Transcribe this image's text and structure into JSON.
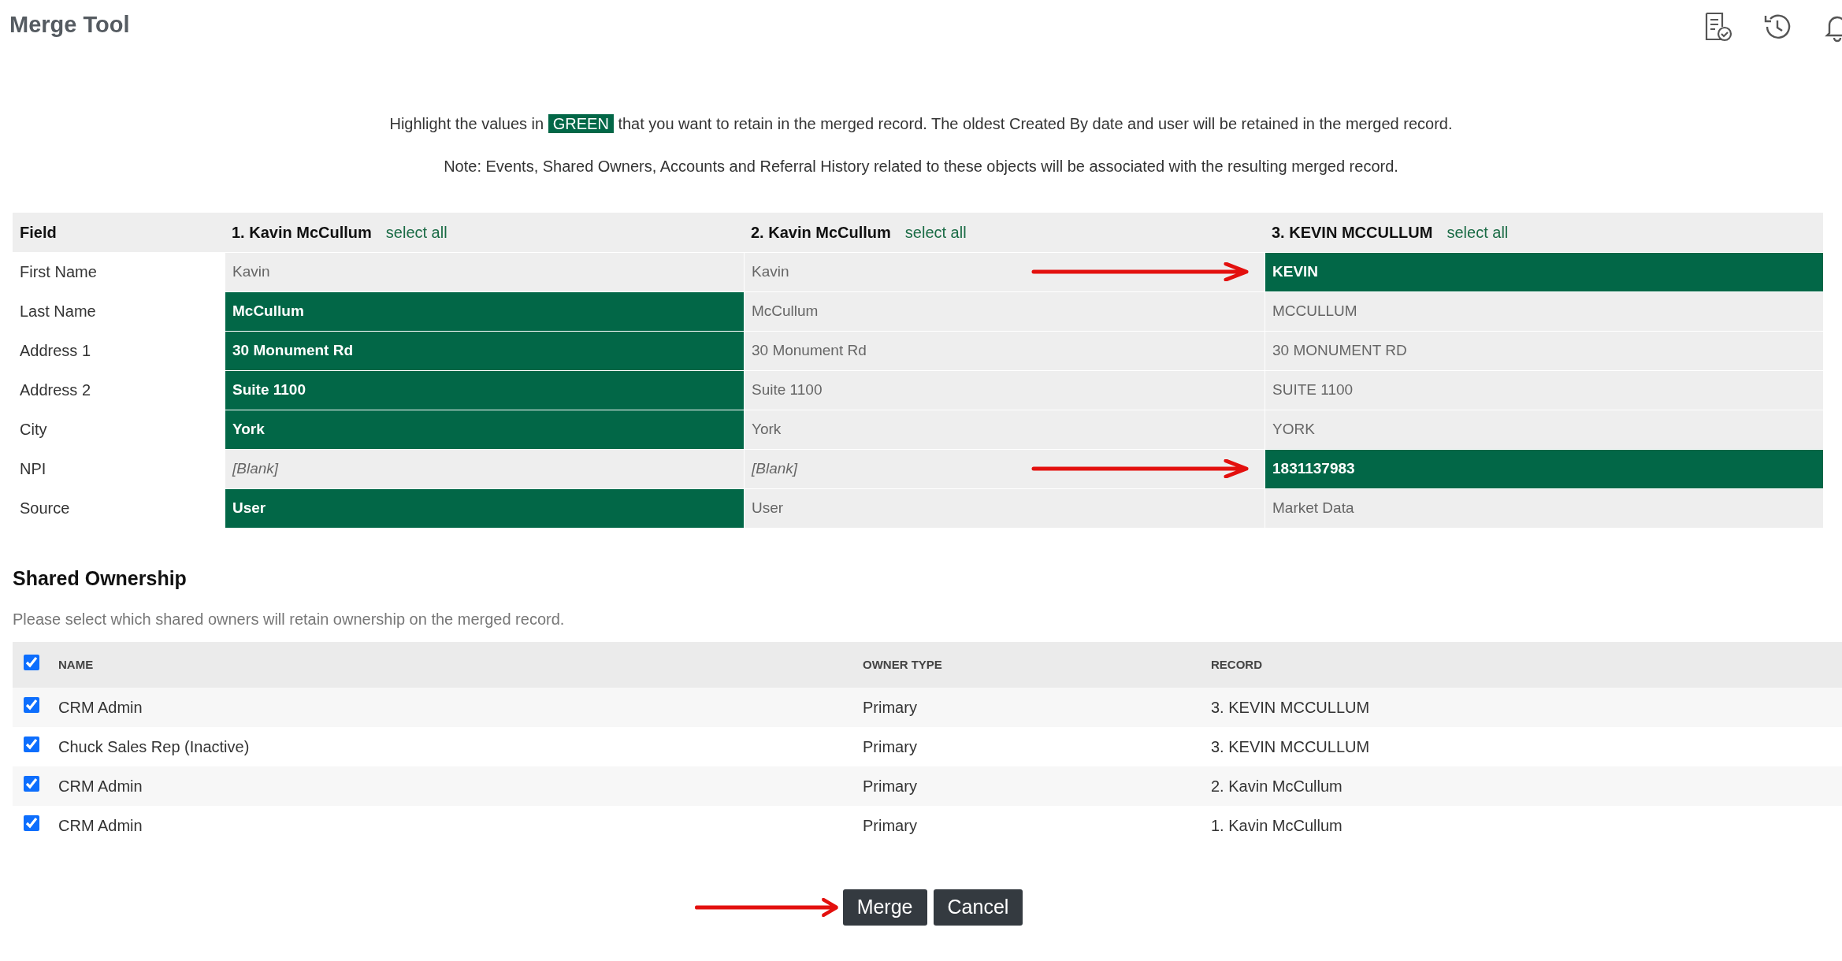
{
  "title": "Merge Tool",
  "intro": {
    "before": "Highlight the values in",
    "highlight": "GREEN",
    "after": "that you want to retain in the merged record. The oldest Created By date and user will be retained in the merged record."
  },
  "note": "Note: Events, Shared Owners, Accounts and Referral History related to these objects will be associated with the resulting merged record.",
  "merge_table": {
    "field_header": "Field",
    "records": [
      {
        "title": "1. Kavin McCullum",
        "link": "select all"
      },
      {
        "title": "2. Kavin McCullum",
        "link": "select all"
      },
      {
        "title": "3. KEVIN MCCULLUM",
        "link": "select all"
      }
    ],
    "rows": [
      {
        "field": "First Name",
        "cells": [
          {
            "text": "Kavin",
            "kind": "value",
            "selected": false
          },
          {
            "text": "Kavin",
            "kind": "value",
            "selected": false
          },
          {
            "text": "KEVIN",
            "kind": "value",
            "selected": true,
            "arrow": true
          }
        ]
      },
      {
        "field": "Last Name",
        "cells": [
          {
            "text": "McCullum",
            "kind": "value",
            "selected": true
          },
          {
            "text": "McCullum",
            "kind": "value",
            "selected": false
          },
          {
            "text": "MCCULLUM",
            "kind": "value",
            "selected": false
          }
        ]
      },
      {
        "field": "Address 1",
        "cells": [
          {
            "text": "30 Monument Rd",
            "kind": "value",
            "selected": true
          },
          {
            "text": "30 Monument Rd",
            "kind": "value",
            "selected": false
          },
          {
            "text": "30 MONUMENT RD",
            "kind": "value",
            "selected": false
          }
        ]
      },
      {
        "field": "Address 2",
        "cells": [
          {
            "text": "Suite 1100",
            "kind": "value",
            "selected": true
          },
          {
            "text": "Suite 1100",
            "kind": "value",
            "selected": false
          },
          {
            "text": "SUITE 1100",
            "kind": "value",
            "selected": false
          }
        ]
      },
      {
        "field": "City",
        "cells": [
          {
            "text": "York",
            "kind": "value",
            "selected": true
          },
          {
            "text": "York",
            "kind": "value",
            "selected": false
          },
          {
            "text": "YORK",
            "kind": "value",
            "selected": false
          }
        ]
      },
      {
        "field": "NPI",
        "cells": [
          {
            "text": "[Blank]",
            "kind": "blank",
            "selected": false
          },
          {
            "text": "[Blank]",
            "kind": "blank",
            "selected": false
          },
          {
            "text": "1831137983",
            "kind": "value",
            "selected": true,
            "arrow": true
          }
        ]
      },
      {
        "field": "Source",
        "cells": [
          {
            "text": "User",
            "kind": "value",
            "selected": true
          },
          {
            "text": "User",
            "kind": "value",
            "selected": false
          },
          {
            "text": "Market Data",
            "kind": "value",
            "selected": false
          }
        ]
      }
    ]
  },
  "shared": {
    "heading": "Shared Ownership",
    "subtitle": "Please select which shared owners will retain ownership on the merged record.",
    "all_checked": true,
    "columns": [
      "NAME",
      "OWNER TYPE",
      "RECORD"
    ],
    "rows": [
      {
        "checked": true,
        "name": "CRM Admin",
        "owner_type": "Primary",
        "record": "3. KEVIN MCCULLUM"
      },
      {
        "checked": true,
        "name": "Chuck Sales Rep (Inactive)",
        "owner_type": "Primary",
        "record": "3. KEVIN MCCULLUM"
      },
      {
        "checked": true,
        "name": "CRM Admin",
        "owner_type": "Primary",
        "record": "2. Kavin McCullum"
      },
      {
        "checked": true,
        "name": "CRM Admin",
        "owner_type": "Primary",
        "record": "1. Kavin McCullum"
      }
    ]
  },
  "buttons": [
    {
      "label": "Merge",
      "arrow": true
    },
    {
      "label": "Cancel"
    }
  ]
}
